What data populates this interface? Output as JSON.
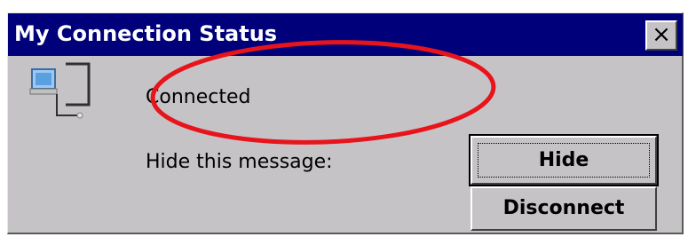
{
  "window": {
    "title": "My Connection Status",
    "close_glyph": "×"
  },
  "status": {
    "text": "Connected",
    "icon": "network-connection-icon"
  },
  "hide_prompt": {
    "label": "Hide this message:"
  },
  "buttons": {
    "hide": "Hide",
    "disconnect": "Disconnect"
  },
  "annotation": {
    "shape": "ellipse",
    "color": "#e8141c"
  },
  "colors": {
    "titlebar": "#00007b",
    "dialog_bg": "#c6c3c6"
  }
}
